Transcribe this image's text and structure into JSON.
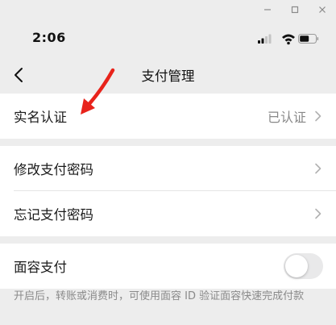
{
  "window_controls": {
    "minimize": "minimize",
    "maximize": "maximize",
    "close": "close"
  },
  "status_bar": {
    "time": "2:06",
    "icons": [
      "signal-icon",
      "wifi-icon",
      "battery-icon"
    ]
  },
  "nav": {
    "title": "支付管理",
    "back_icon": "chevron-left-icon"
  },
  "groups": [
    {
      "rows": [
        {
          "label": "实名认证",
          "value": "已认证",
          "chevron": true
        }
      ]
    },
    {
      "rows": [
        {
          "label": "修改支付密码",
          "chevron": true
        },
        {
          "label": "忘记支付密码",
          "chevron": true
        }
      ]
    },
    {
      "rows": [
        {
          "label": "面容支付",
          "toggle": false
        }
      ]
    }
  ],
  "footnote": "开启后，转账或消费时，可使用面容 ID 验证面容快速完成付款",
  "colors": {
    "background": "#ededed",
    "card": "#ffffff",
    "annotation": "#e8231b",
    "secondary_text": "#888888"
  }
}
